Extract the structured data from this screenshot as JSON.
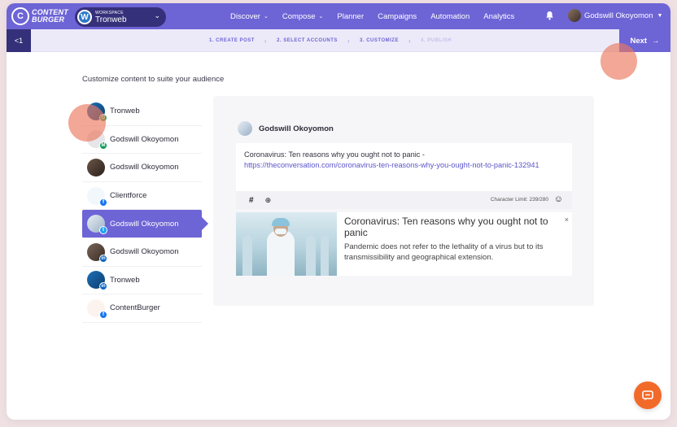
{
  "brand": {
    "logo_line1": "CONTENT",
    "logo_line2": "BURGER"
  },
  "workspace": {
    "label": "WORKSPACE",
    "name": "Tronweb"
  },
  "nav": {
    "items": [
      {
        "label": "Discover",
        "has_dropdown": true
      },
      {
        "label": "Compose",
        "has_dropdown": true
      },
      {
        "label": "Planner",
        "has_dropdown": false
      },
      {
        "label": "Campaigns",
        "has_dropdown": false
      },
      {
        "label": "Automation",
        "has_dropdown": false
      },
      {
        "label": "Analytics",
        "has_dropdown": false
      }
    ],
    "user_name": "Godswill Okoyomon"
  },
  "wizard": {
    "back_label": "<1",
    "steps": [
      {
        "label": "1. CREATE POST",
        "state": "done"
      },
      {
        "label": "2. SELECT ACCOUNTS",
        "state": "done"
      },
      {
        "label": "3. CUSTOMIZE",
        "state": "current"
      },
      {
        "label": "4. PUBLISH",
        "state": "pending"
      }
    ],
    "next_label": "Next"
  },
  "page": {
    "subtitle": "Customize content to suite your audience"
  },
  "accounts": [
    {
      "name": "Tronweb",
      "network": "google-my-business",
      "active": false
    },
    {
      "name": "Godswill Okoyomon",
      "network": "medium",
      "active": false
    },
    {
      "name": "Godswill Okoyomon",
      "network": "facebook-profile",
      "active": false
    },
    {
      "name": "Clientforce",
      "network": "facebook",
      "active": false
    },
    {
      "name": "Godswill Okoyomon",
      "network": "twitter",
      "active": true
    },
    {
      "name": "Godswill Okoyomon",
      "network": "linkedin",
      "active": false
    },
    {
      "name": "Tronweb",
      "network": "linkedin",
      "active": false
    },
    {
      "name": "ContentBurger",
      "network": "facebook",
      "active": false
    }
  ],
  "post": {
    "author": "Godswill Okoyomon",
    "text_line": "Coronavirus: Ten reasons why you ought not to panic -",
    "link": "https://theconversation.com/coronavirus-ten-reasons-why-you-ought-not-to-panic-132941",
    "toolbar": {
      "hashtag_icon": "#",
      "target_icon": "⊕",
      "char_limit": "Character Limit: 239/280",
      "emoji_icon": "☺"
    },
    "preview": {
      "title": "Coronavirus: Ten reasons why you ought not to panic",
      "description": "Pandemic does not refer to the lethality of a virus but to its transmissibility and geographical extension."
    }
  },
  "colors": {
    "primary": "#6d64d6",
    "primary_dark": "#35307a",
    "accent_orange": "#f26a2a",
    "link": "#5b55c9"
  }
}
